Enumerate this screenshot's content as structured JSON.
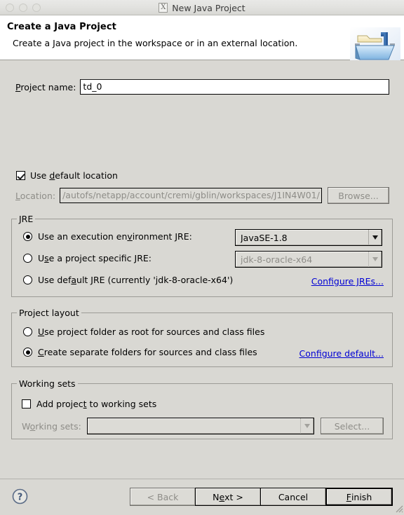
{
  "window": {
    "title": "New Java Project",
    "title_icon": "x-box-icon",
    "controls": [
      "close-circle",
      "minimize-circle",
      "maximize-circle"
    ]
  },
  "header": {
    "title": "Create a Java Project",
    "subtitle": "Create a Java project in the workspace or in an external location.",
    "icon": "java-project-folder-icon"
  },
  "project_name": {
    "label_pre": "P",
    "label_mnemonic": "",
    "label": "Project name:",
    "value": "td_0",
    "placeholder": ""
  },
  "default_location": {
    "label": "Use default location",
    "checked": true
  },
  "location": {
    "label": "Location:",
    "value": "/autofs/netapp/account/cremi/gblin/workspaces/J1IN4W01/",
    "browse_label": "Browse...",
    "enabled": false
  },
  "jre": {
    "legend": "JRE",
    "options": [
      {
        "label": "Use an execution environment JRE:",
        "selected": true
      },
      {
        "label": "Use a project specific JRE:",
        "selected": false
      },
      {
        "label": "Use default JRE (currently 'jdk-8-oracle-x64')",
        "selected": false
      }
    ],
    "execution_env_value": "JavaSE-1.8",
    "project_jre_value": "jdk-8-oracle-x64",
    "configure_link": "Configure JREs..."
  },
  "project_layout": {
    "legend": "Project layout",
    "options": [
      {
        "label": "Use project folder as root for sources and class files",
        "selected": false
      },
      {
        "label": "Create separate folders for sources and class files",
        "selected": true
      }
    ],
    "configure_link": "Configure default..."
  },
  "working_sets": {
    "legend": "Working sets",
    "add_label": "Add project to working sets",
    "add_checked": false,
    "field_label": "Working sets:",
    "field_value": "",
    "select_label": "Select..."
  },
  "footer": {
    "help_icon": "help-question-icon",
    "buttons": [
      {
        "name": "back",
        "label": "< Back",
        "disabled": true,
        "default": false
      },
      {
        "name": "next",
        "label": "Next >",
        "disabled": false,
        "default": false
      },
      {
        "name": "cancel",
        "label": "Cancel",
        "disabled": false,
        "default": false
      },
      {
        "name": "finish",
        "label": "Finish",
        "disabled": false,
        "default": true
      }
    ]
  },
  "colors": {
    "dialog_bg": "#d9d8d3",
    "header_bg": "#ffffff",
    "link": "#0000d4",
    "field_bg": "#ffffff",
    "disabled_text": "#8e8d88"
  }
}
